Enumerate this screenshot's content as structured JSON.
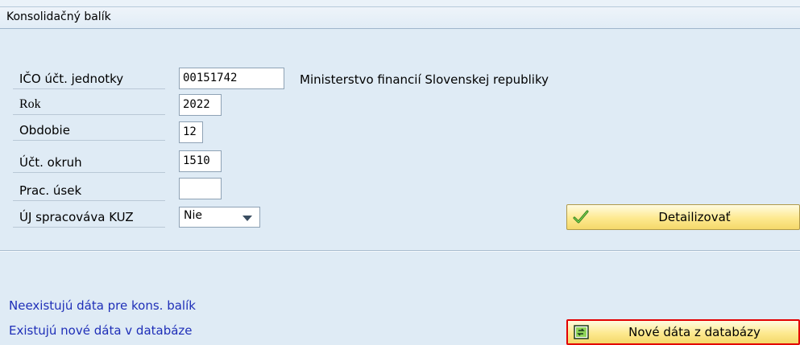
{
  "title": "Konsolidačný balík",
  "form": {
    "ico": {
      "label": "IČO účt. jednotky",
      "value": "00151742",
      "description": "Ministerstvo financií Slovenskej republiky"
    },
    "rok": {
      "label": "Rok",
      "value": "2022"
    },
    "obdobie": {
      "label": "Obdobie",
      "value": "12"
    },
    "okruh": {
      "label": "Účt. okruh",
      "value": "1510"
    },
    "usek": {
      "label": "Prac. úsek",
      "value": ""
    },
    "kuz": {
      "label": "ÚJ spracováva KUZ",
      "value": "Nie"
    }
  },
  "buttons": {
    "detail": {
      "label": "Detailizovať",
      "icon": "checkmark-icon"
    },
    "new_data": {
      "label": "Nové dáta z databázy",
      "icon": "refresh-data-icon"
    }
  },
  "messages": {
    "no_data": "Neexistujú dáta pre kons. balík",
    "new_data": "Existujú nové dáta v databáze"
  },
  "colors": {
    "accent_button": "#fde98f",
    "message_text": "#1f2fb8",
    "highlight_border": "#e30000"
  }
}
